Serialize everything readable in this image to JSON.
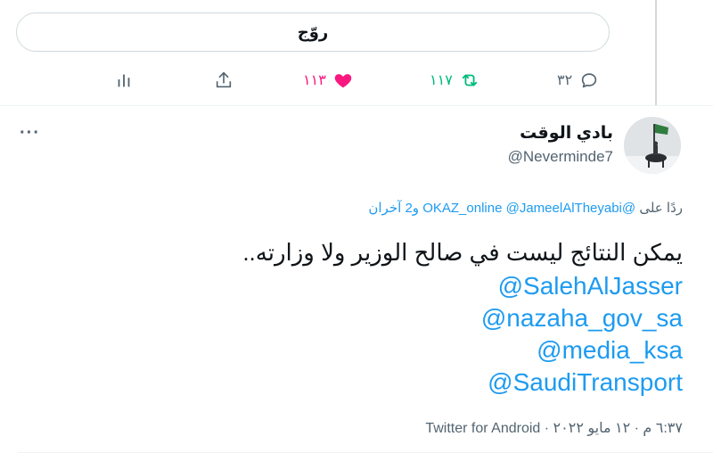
{
  "reply_box": {
    "label": "روّج"
  },
  "actions": {
    "replies": "٣٢",
    "retweets": "١١٧",
    "likes": "١١٣",
    "colors": {
      "retweet": "#00ba7c",
      "like": "#f91880",
      "neutral": "#536471"
    },
    "icons": [
      "comment-icon",
      "retweet-icon",
      "heart-icon",
      "share-icon",
      "analytics-icon",
      "more-icon"
    ]
  },
  "tweet": {
    "author_name": "بادي الوقت",
    "author_handle": "@Neverminde7",
    "replying_prefix": "ردًا على",
    "replying_to": [
      "@OKAZ_online",
      "@JameelAlTheyabi"
    ],
    "replying_more": "و2 آخران",
    "text": "يمكن النتائج ليست في صالح الوزير ولا وزارته..",
    "mentions": [
      "@SalehAlJasser",
      "@nazaha_gov_sa",
      "@media_ksa",
      "@SaudiTransport"
    ],
    "time": "٦:٣٧ م",
    "date": "١٢ مايو ٢٠٢٢",
    "source": "Twitter for Android",
    "separator": "·"
  }
}
